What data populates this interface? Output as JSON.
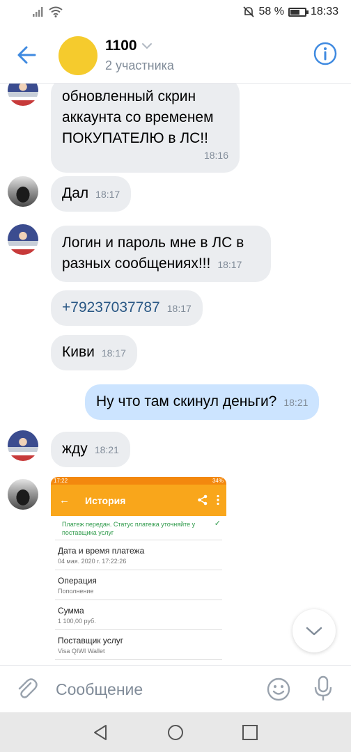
{
  "status_bar": {
    "battery": "58 %",
    "time": "18:33",
    "battery_level": 0.58
  },
  "header": {
    "title": "1100",
    "subtitle": "2 участника",
    "avatar_color": "#f5cb2d"
  },
  "messages": [
    {
      "lines": [
        "обновленный скрин",
        "аккаунта со временем",
        "ПОКУПАТЕЛЮ в ЛС!!"
      ],
      "time": "18:16"
    },
    {
      "text": "Дал",
      "time": "18:17"
    },
    {
      "lines": [
        "Логин и пароль мне в ЛС в",
        "разных сообщениях!!!"
      ],
      "time": "18:17"
    },
    {
      "text": "+79237037787",
      "time": "18:17"
    },
    {
      "text": "Киви",
      "time": "18:17"
    },
    {
      "text": "Ну что там скинул деньги?",
      "time": "18:21"
    },
    {
      "text": "жду",
      "time": "18:21"
    }
  ],
  "photo": {
    "status_time": "17:22",
    "battery": "34%",
    "title": "История",
    "status_line": "Платеж передан. Статус платежа уточняйте у поставщика услуг",
    "rows": [
      {
        "label": "Дата и время платежа",
        "value": "04 мая. 2020 г. 17:22:26"
      },
      {
        "label": "Операция",
        "value": "Пополнение"
      },
      {
        "label": "Сумма",
        "value": "1 100,00 руб."
      },
      {
        "label": "Поставщик услуг",
        "value": "Visa QIWI Wallet"
      }
    ]
  },
  "compose": {
    "placeholder": "Сообщение"
  },
  "colors": {
    "accent": "#3f8ae0",
    "incoming_bubble": "#ebedf0",
    "outgoing_bubble": "#cce4ff",
    "qiwi_orange": "#f9a61b"
  },
  "icons": [
    "back-arrow-icon",
    "chevron-down-icon",
    "info-icon",
    "attach-icon",
    "emoji-icon",
    "mic-icon",
    "nav-back-icon",
    "nav-home-icon",
    "nav-recents-icon",
    "scroll-down-icon"
  ]
}
